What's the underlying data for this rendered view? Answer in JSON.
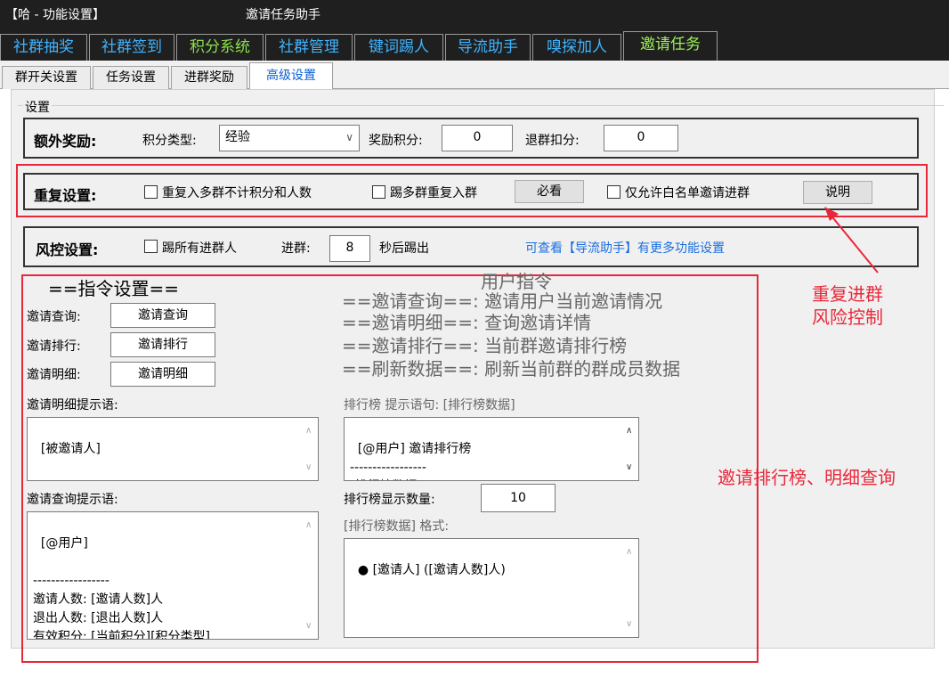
{
  "window": {
    "title_left": "【哈   - 功能设置】",
    "title_app": "邀请任务助手"
  },
  "main_tabs": [
    {
      "label": "社群抽奖",
      "color": "blue"
    },
    {
      "label": "社群签到",
      "color": "blue"
    },
    {
      "label": "积分系统",
      "color": "green"
    },
    {
      "label": "社群管理",
      "color": "blue"
    },
    {
      "label": "键词踢人",
      "color": "blue"
    },
    {
      "label": "导流助手",
      "color": "blue"
    },
    {
      "label": "嗅探加人",
      "color": "blue"
    },
    {
      "label": "邀请任务",
      "color": "green",
      "active": true
    }
  ],
  "sub_tabs": [
    "群开关设置",
    "任务设置",
    "进群奖励",
    "高级设置"
  ],
  "settings_group_label": "设置",
  "extra_reward": {
    "title": "额外奖励:",
    "points_type_label": "积分类型:",
    "points_type_value": "经验",
    "reward_points_label": "奖励积分:",
    "reward_points_value": "0",
    "leave_deduct_label": "退群扣分:",
    "leave_deduct_value": "0"
  },
  "repeat_settings": {
    "title": "重复设置:",
    "opt1": "重复入多群不计积分和人数",
    "opt2": "踢多群重复入群",
    "must_read_button": "必看",
    "opt3": "仅允许白名单邀请进群",
    "explain_button": "说明"
  },
  "risk_settings": {
    "title": "风控设置:",
    "kick_all_label": "踢所有进群人",
    "join_label": "进群:",
    "seconds_value": "8",
    "after_label": "秒后踢出",
    "link_text": "可查看【导流助手】有更多功能设置"
  },
  "annotations": {
    "repeat_risk_line1": "重复进群",
    "repeat_risk_line2": "风险控制",
    "rank_detail": "邀请排行榜、明细查询"
  },
  "commands": {
    "header": "==指令设置==",
    "user_cmd_header": "用户指令",
    "rows": [
      {
        "label": "邀请查询:",
        "value": "邀请查询"
      },
      {
        "label": "邀请排行:",
        "value": "邀请排行"
      },
      {
        "label": "邀请明细:",
        "value": "邀请明细"
      }
    ],
    "descriptions": [
      "==邀请查询==:   邀请用户当前邀请情况",
      "==邀请明细==:   查询邀请详情",
      "==邀请排行==:   当前群邀请排行榜",
      "==刷新数据==:   刷新当前群的群成员数据"
    ]
  },
  "detail_prompt": {
    "label": "邀请明细提示语:",
    "text": "[被邀请人]"
  },
  "rank_prompt": {
    "label": "排行榜 提示语句:  [排行榜数据]",
    "text": "[@用户] 邀请排行榜\n-----------------\n[排行榜数据]"
  },
  "query_prompt": {
    "label": "邀请查询提示语:",
    "text": "[@用户]\n\n-----------------\n邀请人数: [邀请人数]人\n退出人数: [退出人数]人\n有效积分: [当前积分][积分类型]"
  },
  "rank_count": {
    "label": "排行榜显示数量:",
    "value": "10"
  },
  "rank_format": {
    "label": "[排行榜数据] 格式:",
    "text": "● [邀请人] ([邀请人数]人)"
  }
}
